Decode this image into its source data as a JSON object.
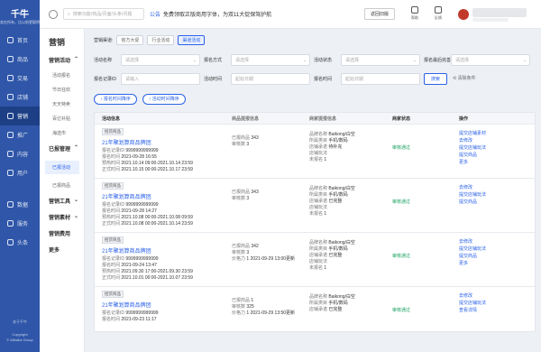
{
  "brand": {
    "name": "千牛",
    "slogan": "卖在所有，比以前更聪明"
  },
  "nav": [
    {
      "label": "首页",
      "icon": "home-icon"
    },
    {
      "label": "商品",
      "icon": "goods-icon"
    },
    {
      "label": "交易",
      "icon": "trade-icon"
    },
    {
      "label": "店铺",
      "icon": "shop-icon"
    },
    {
      "label": "营销",
      "icon": "marketing-icon"
    },
    {
      "label": "推广",
      "icon": "promotion-icon"
    },
    {
      "label": "内容",
      "icon": "content-icon"
    },
    {
      "label": "用户",
      "icon": "user-icon"
    },
    {
      "label": "数据",
      "icon": "data-icon"
    },
    {
      "label": "服务",
      "icon": "service-icon"
    },
    {
      "label": "头条",
      "icon": "news-icon"
    }
  ],
  "footer": {
    "about": "关于千牛",
    "copyright": "Copyright",
    "company": "© Alibaba Group"
  },
  "submenu": {
    "title": "营销",
    "g1": "营销活动",
    "g1_items": [
      "活动报名",
      "节日狂欢",
      "天天特卖",
      "百亿补贴",
      "海选市"
    ],
    "g2": "已报管理",
    "g2_items": [
      "已报活动",
      "已报商品"
    ],
    "g3": "营销工具",
    "g4": "营销素材",
    "g5": "营销费用",
    "g6": "更多"
  },
  "topbar": {
    "search_placeholder": "搜索功能/商品/页面/头条/问题",
    "notice_tag": "公告",
    "notice_text": "免费领取正版商用字体，为双11大促保驾护航",
    "back_label": "返回旧版",
    "help": "帮助",
    "feedback": "反馈"
  },
  "channel": {
    "label": "营销渠道:",
    "options": [
      "官方大促",
      "行业活动",
      "渠道活动"
    ],
    "selected": "渠道活动"
  },
  "filters": [
    {
      "label": "活动名称",
      "placeholder": "请选择"
    },
    {
      "label": "报名方式",
      "placeholder": "请选择"
    },
    {
      "label": "活动状态",
      "placeholder": "请选择"
    },
    {
      "label": "报名最后完善",
      "placeholder": "请选择"
    },
    {
      "label": "报名记录ID",
      "placeholder": "请输入"
    },
    {
      "label": "活动时间",
      "placeholder": "起始日期"
    },
    {
      "label": "报名时间",
      "placeholder": "起始日期"
    }
  ],
  "query_label": "搜索",
  "clear_label": "清除条件",
  "sorts": [
    "报名时间降序",
    "活动时间降序"
  ],
  "table": {
    "headers": [
      "活动信息",
      "商品提报信息",
      "商家提报信息",
      "商家状态",
      "操作"
    ],
    "rows": [
      {
        "tag": "招货商品",
        "title": "21年聚划算商品牌团",
        "id": "9999999999999",
        "reg": "2021-09-28 16:55",
        "pre": "2021.10.14 09:00-2021.10.14 23:59",
        "off": "2021.10.15 00:00-2021.10.17 23:59",
        "g1": "343",
        "g2": "3",
        "brand": "Baikong/白空",
        "cat": "手机/数码",
        "promo": "待补充",
        "extra": "1",
        "status": "审核通过",
        "ops": [
          "提交店铺素材",
          "去修改",
          "提交店铺玩法",
          "提交商品",
          "更多"
        ]
      },
      {
        "tag": "招货商品",
        "title": "21年聚划算商品牌团",
        "id": "9999999999999",
        "reg": "2021-09-28 14:27",
        "pre": "2021.10.08 00:00-2021.10.08 09:59",
        "off": "2021.10.08 00:00-2021.10.14 23:59",
        "g1": "343",
        "g2": "3",
        "brand": "Baikong/白空",
        "cat": "手机/数码",
        "promo": "已完整",
        "extra": "1",
        "status": "审核通过",
        "ops": [
          "去修改",
          "提交店铺玩法",
          "提交商品"
        ]
      },
      {
        "tag": "招货商品",
        "title": "21年聚划算商品牌团",
        "id": "9999999999999",
        "reg": "2021-09-24 13:47",
        "pre": "2021.09.30 17:00-2021.09.30 23:59",
        "off": "2021.10.01 00:00-2021.10.07 23:59",
        "g1": "342",
        "g2": "3",
        "g3": "1 2021-09-29 13:00更新",
        "brand": "Baikong/白空",
        "cat": "手机/数码",
        "promo": "已完整",
        "extra": "1",
        "status": "审核通过",
        "ops": [
          "去修改",
          "提交店铺玩法",
          "提交商品",
          "更多"
        ]
      },
      {
        "tag": "招货商品",
        "title": "21年聚划算商品牌团",
        "id": "9999999999999",
        "reg": "2021-09-23 11:17",
        "g1": "1",
        "g2": "325",
        "g3": "1 2021-09-29 13:50更新",
        "brand": "Baikong/白空",
        "cat": "手机/数码",
        "promo": "已完整",
        "status": "审核通过",
        "ops": [
          "去修改",
          "提交店铺玩法",
          "查看详情"
        ]
      }
    ]
  },
  "labels": {
    "regid": "报名记录ID",
    "regtime": "报名时间",
    "pretime": "预热时间",
    "offtime": "正式时间",
    "g1": "已报商品",
    "g2": "审核数",
    "g3": "价格力",
    "brand": "品牌名称",
    "cat": "所属类目",
    "promo": "店铺承诺",
    "extra": "店铺玩法",
    "vacant": "未报名"
  },
  "colors": {
    "sidebar": "#2f56a8",
    "accent": "#2b62e8",
    "success": "#1aa260"
  }
}
